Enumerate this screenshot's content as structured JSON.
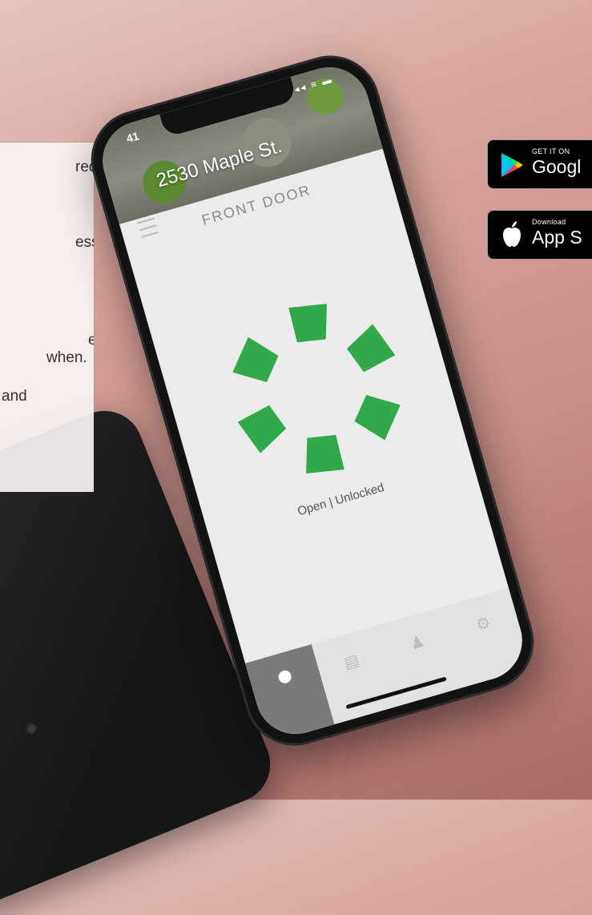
{
  "info_panel": {
    "lines": [
      "red",
      "ess",
      "e",
      "when.",
      "and"
    ]
  },
  "phone": {
    "status_time": "41",
    "status_icons": "◂◂ ≡ ▬",
    "address": "2530 Maple St.",
    "door_name": "FRONT DOOR",
    "lock_status": "Open | Unlocked",
    "tabs": [
      {
        "name": "home-tab",
        "icon": "dot"
      },
      {
        "name": "log-tab",
        "icon": "log-icon"
      },
      {
        "name": "users-tab",
        "icon": "users-icon"
      },
      {
        "name": "settings-tab",
        "icon": "gear-icon"
      }
    ],
    "accent_color": "#31a94a"
  },
  "badges": {
    "google": {
      "small": "GET IT ON",
      "big": "Googl"
    },
    "apple": {
      "small": "Download",
      "big": "App S"
    }
  }
}
